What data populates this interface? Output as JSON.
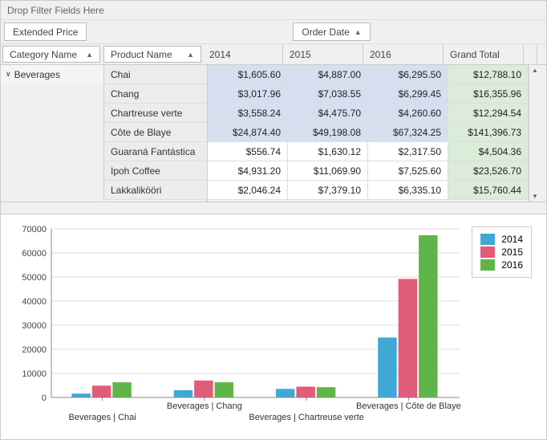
{
  "filter_drop_text": "Drop Filter Fields Here",
  "data_field": "Extended Price",
  "col_field": "Order Date",
  "row_fields": {
    "category": "Category Name",
    "product": "Product Name"
  },
  "col_headers": {
    "y2014": "2014",
    "y2015": "2015",
    "y2016": "2016",
    "grand_total": "Grand Total"
  },
  "category_value": "Beverages",
  "rows": [
    {
      "product": "Chai",
      "y2014": "$1,605.60",
      "y2015": "$4,887.00",
      "y2016": "$6,295.50",
      "gt": "$12,788.10",
      "hi": true
    },
    {
      "product": "Chang",
      "y2014": "$3,017.96",
      "y2015": "$7,038.55",
      "y2016": "$6,299.45",
      "gt": "$16,355.96",
      "hi": true
    },
    {
      "product": "Chartreuse verte",
      "y2014": "$3,558.24",
      "y2015": "$4,475.70",
      "y2016": "$4,260.60",
      "gt": "$12,294.54",
      "hi": true
    },
    {
      "product": "Côte de Blaye",
      "y2014": "$24,874.40",
      "y2015": "$49,198.08",
      "y2016": "$67,324.25",
      "gt": "$141,396.73",
      "hi": true
    },
    {
      "product": "Guaraná Fantástica",
      "y2014": "$556.74",
      "y2015": "$1,630.12",
      "y2016": "$2,317.50",
      "gt": "$4,504.36",
      "hi": false
    },
    {
      "product": "Ipoh Coffee",
      "y2014": "$4,931.20",
      "y2015": "$11,069.90",
      "y2016": "$7,525.60",
      "gt": "$23,526.70",
      "hi": false
    },
    {
      "product": "Lakkalikööri",
      "y2014": "$2,046.24",
      "y2015": "$7,379.10",
      "y2016": "$6,335.10",
      "gt": "$15,760.44",
      "hi": false
    }
  ],
  "legend": {
    "y2014": "2014",
    "y2015": "2015",
    "y2016": "2016"
  },
  "x_labels": {
    "chai": "Beverages | Chai",
    "chang": "Beverages | Chang",
    "chart": "Beverages | Chartreuse verte",
    "cote": "Beverages | Côte de Blaye"
  },
  "chart_data": {
    "type": "bar",
    "categories": [
      "Beverages | Chai",
      "Beverages | Chang",
      "Beverages | Chartreuse verte",
      "Beverages | Côte de Blaye"
    ],
    "series": [
      {
        "name": "2014",
        "values": [
          1605.6,
          3017.96,
          3558.24,
          24874.4
        ],
        "color": "#3fa8d4"
      },
      {
        "name": "2015",
        "values": [
          4887.0,
          7038.55,
          4475.7,
          49198.08
        ],
        "color": "#e05c79"
      },
      {
        "name": "2016",
        "values": [
          6295.5,
          6299.45,
          4260.6,
          67324.25
        ],
        "color": "#5fb548"
      }
    ],
    "ylim": [
      0,
      70000
    ],
    "yticks": [
      0,
      10000,
      20000,
      30000,
      40000,
      50000,
      60000,
      70000
    ],
    "xlabel": "",
    "ylabel": "",
    "title": ""
  }
}
